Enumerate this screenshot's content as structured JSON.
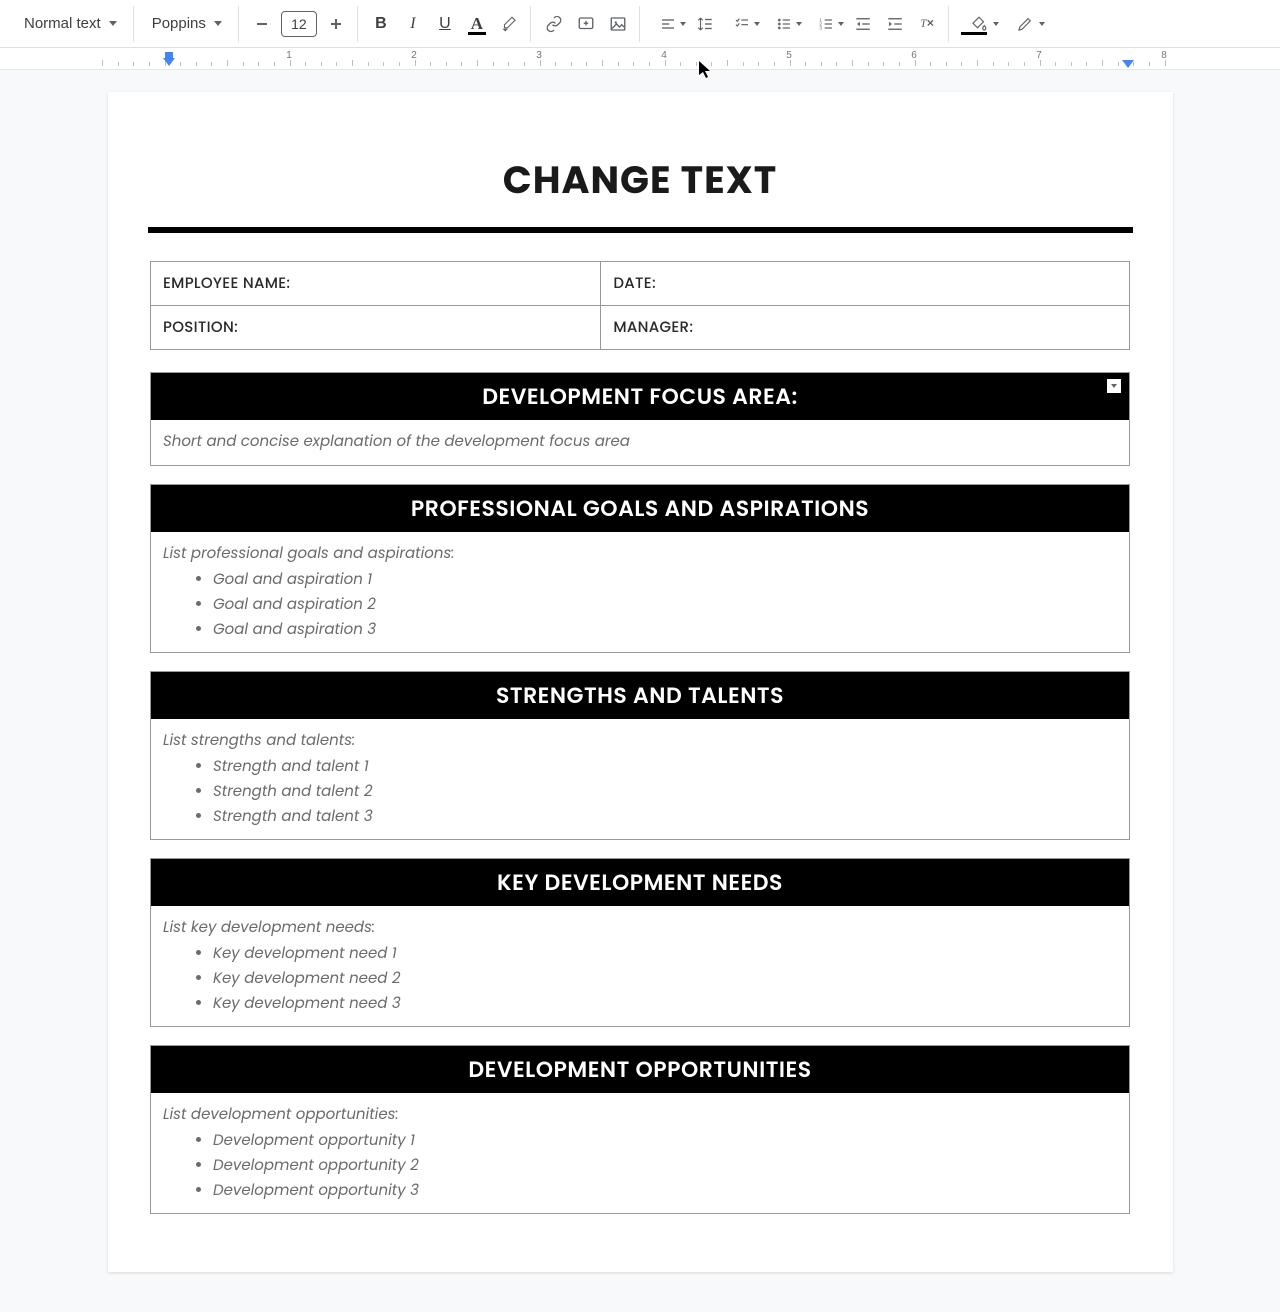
{
  "toolbar": {
    "styleSelect": "Normal text",
    "fontSelect": "Poppins",
    "fontSize": "12"
  },
  "ruler": {
    "numbers": [
      "1",
      "2",
      "3",
      "4",
      "5",
      "6",
      "7",
      "8"
    ]
  },
  "doc": {
    "title": "CHANGE TEXT",
    "info": {
      "employeeName": "EMPLOYEE NAME:",
      "date": "DATE:",
      "position": "POSITION:",
      "manager": "MANAGER:"
    },
    "sections": [
      {
        "header": "DEVELOPMENT FOCUS AREA:",
        "hasMarker": true,
        "lead": "Short and concise explanation of the development focus area",
        "items": []
      },
      {
        "header": "PROFESSIONAL GOALS AND ASPIRATIONS",
        "lead": "List professional goals and aspirations:",
        "items": [
          "Goal and aspiration 1",
          "Goal and aspiration 2",
          "Goal and aspiration 3"
        ]
      },
      {
        "header": "STRENGTHS AND TALENTS",
        "lead": "List strengths and talents:",
        "items": [
          "Strength and talent 1",
          "Strength and talent 2",
          "Strength and talent 3"
        ]
      },
      {
        "header": "KEY DEVELOPMENT NEEDS",
        "lead": "List key development needs:",
        "items": [
          "Key development need 1",
          "Key development need 2",
          "Key development need 3"
        ]
      },
      {
        "header": "DEVELOPMENT OPPORTUNITIES",
        "lead": "List development opportunities:",
        "items": [
          "Development opportunity  1",
          "Development opportunity  2",
          "Development opportunity  3"
        ]
      }
    ]
  }
}
